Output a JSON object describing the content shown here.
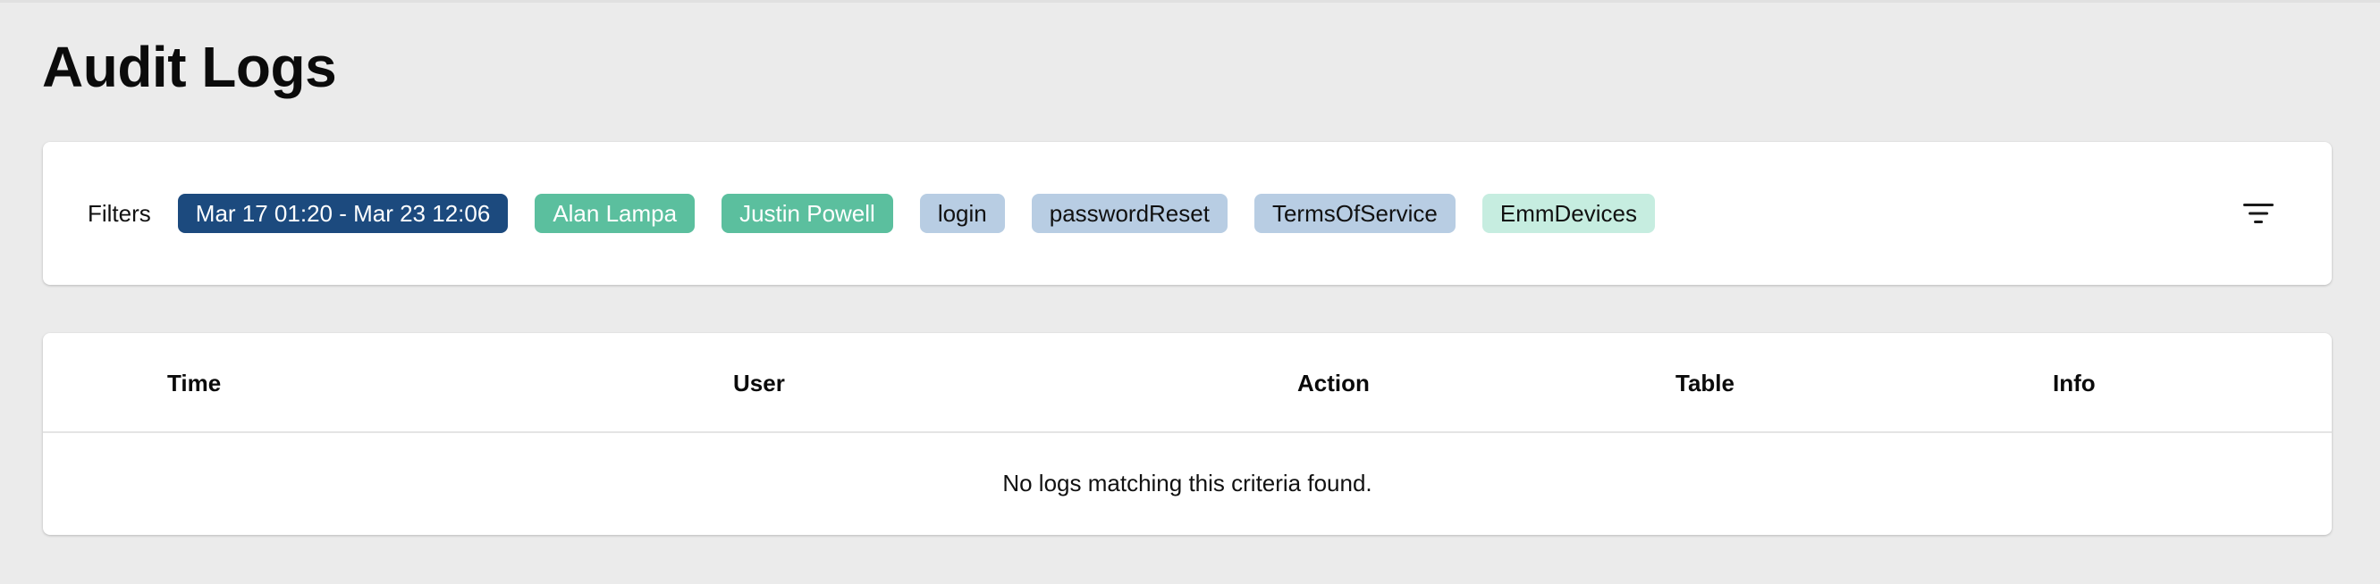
{
  "page": {
    "title": "Audit Logs"
  },
  "filters": {
    "label": "Filters",
    "chips": [
      {
        "label": "Mar 17 01:20 - Mar 23 12:06",
        "kind": "date-range",
        "color": "#1c4a7e"
      },
      {
        "label": "Alan Lampa",
        "kind": "user",
        "color": "#5bbf9e"
      },
      {
        "label": "Justin Powell",
        "kind": "user",
        "color": "#5bbf9e"
      },
      {
        "label": "login",
        "kind": "action",
        "color": "#b8cde3"
      },
      {
        "label": "passwordReset",
        "kind": "action",
        "color": "#b8cde3"
      },
      {
        "label": "TermsOfService",
        "kind": "action",
        "color": "#b8cde3"
      },
      {
        "label": "EmmDevices",
        "kind": "table",
        "color": "#c6ede0"
      }
    ],
    "toggle_icon": "filter-list-icon"
  },
  "logs": {
    "columns": [
      "Time",
      "User",
      "Action",
      "Table",
      "Info"
    ],
    "empty_message": "No logs matching this criteria found."
  }
}
